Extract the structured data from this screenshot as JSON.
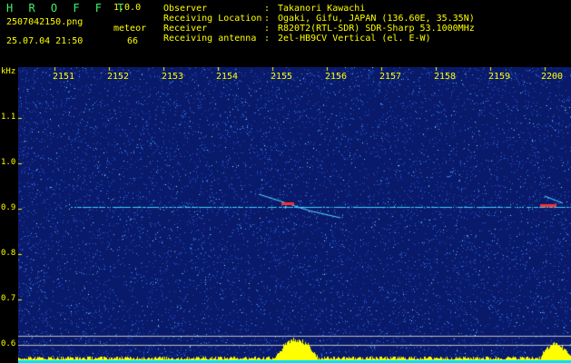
{
  "header": {
    "app_title": "H R O F F T",
    "app_version": "1.0.0",
    "file_name": "2507042150.png",
    "mode": "meteor",
    "date_time": "25.07.04 21:50",
    "count": "66"
  },
  "info": [
    {
      "label": "Observer",
      "value": "Takanori Kawachi"
    },
    {
      "label": "Receiving Location",
      "value": "Ogaki, Gifu, JAPAN (136.60E, 35.35N)"
    },
    {
      "label": "Receiver",
      "value": "R820T2(RTL-SDR) SDR-Sharp 53.1000MHz"
    },
    {
      "label": "Receiving antenna",
      "value": "2el-HB9CV Vertical (el. E-W)"
    }
  ],
  "axis": {
    "y_unit": "kHz",
    "y_ticks": [
      "1.1",
      "1.0",
      "0.9",
      "0.8",
      "0.7",
      "0.6"
    ],
    "x_ticks": [
      "2151",
      "2152",
      "2153",
      "2154",
      "2155",
      "2156",
      "2157",
      "2158",
      "2159",
      "2200"
    ]
  },
  "colors": {
    "background_noise": "#0a1a6a",
    "label_yellow": "#ffff00",
    "title_green": "#41f06a",
    "carrier": "#40d0ff",
    "meteor_head": "#ff3030"
  }
}
